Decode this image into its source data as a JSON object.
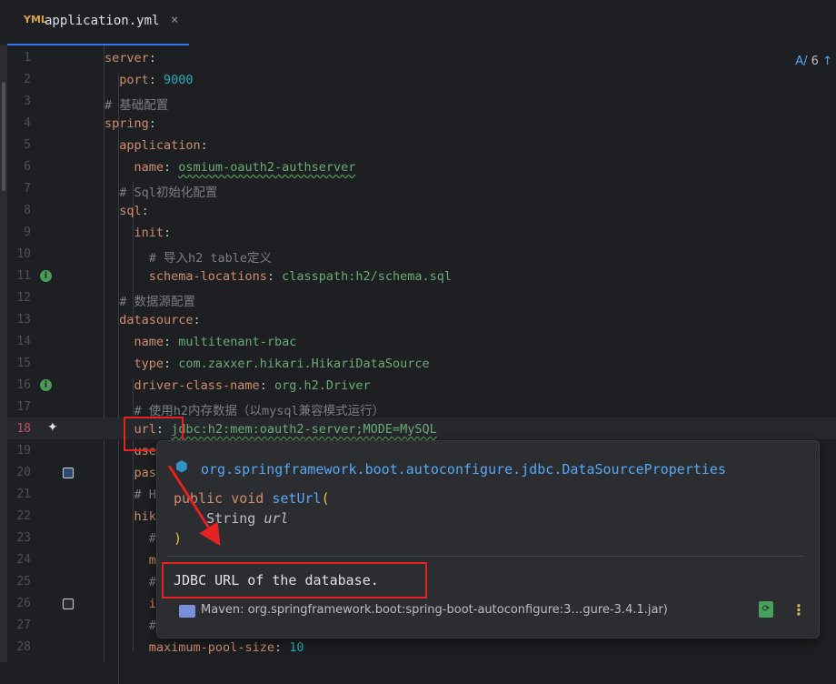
{
  "tab": {
    "icon": "yaml-file-icon",
    "icon_text": "YML",
    "title": "application.yml",
    "close": "×"
  },
  "top_right": {
    "inspection_icon": "A/",
    "count": "6",
    "arrow": "↑"
  },
  "lines": [
    {
      "n": "1",
      "segs": [
        {
          "t": "k",
          "v": "server"
        },
        {
          "t": "s",
          "v": ":"
        }
      ]
    },
    {
      "n": "2",
      "segs": [
        {
          "t": "s",
          "v": "  "
        },
        {
          "t": "k",
          "v": "port"
        },
        {
          "t": "s",
          "v": ": "
        },
        {
          "t": "n",
          "v": "9000"
        }
      ]
    },
    {
      "n": "3",
      "segs": [
        {
          "t": "c",
          "v": "# 基础配置"
        }
      ]
    },
    {
      "n": "4",
      "segs": [
        {
          "t": "k",
          "v": "spring"
        },
        {
          "t": "s",
          "v": ":"
        }
      ]
    },
    {
      "n": "5",
      "segs": [
        {
          "t": "s",
          "v": "  "
        },
        {
          "t": "k",
          "v": "application"
        },
        {
          "t": "s",
          "v": ":"
        }
      ]
    },
    {
      "n": "6",
      "segs": [
        {
          "t": "s",
          "v": "    "
        },
        {
          "t": "k",
          "v": "name"
        },
        {
          "t": "s",
          "v": ": "
        },
        {
          "t": "v",
          "v": "osmium-oauth2-authserver"
        }
      ]
    },
    {
      "n": "7",
      "segs": [
        {
          "t": "s",
          "v": "  "
        },
        {
          "t": "c",
          "v": "# Sql初始化配置"
        }
      ]
    },
    {
      "n": "8",
      "segs": [
        {
          "t": "s",
          "v": "  "
        },
        {
          "t": "k",
          "v": "sql"
        },
        {
          "t": "s",
          "v": ":"
        }
      ]
    },
    {
      "n": "9",
      "segs": [
        {
          "t": "s",
          "v": "    "
        },
        {
          "t": "k",
          "v": "init"
        },
        {
          "t": "s",
          "v": ":"
        }
      ]
    },
    {
      "n": "10",
      "segs": [
        {
          "t": "s",
          "v": "      "
        },
        {
          "t": "c",
          "v": "# 导入h2 table定义"
        }
      ]
    },
    {
      "n": "11",
      "gutter": "info",
      "segs": [
        {
          "t": "s",
          "v": "      "
        },
        {
          "t": "k",
          "v": "schema-locations"
        },
        {
          "t": "s",
          "v": ": "
        },
        {
          "t": "v",
          "v": "classpath:h2/schema.sql"
        }
      ]
    },
    {
      "n": "12",
      "segs": [
        {
          "t": "s",
          "v": "  "
        },
        {
          "t": "c",
          "v": "# 数据源配置"
        }
      ]
    },
    {
      "n": "13",
      "segs": [
        {
          "t": "s",
          "v": "  "
        },
        {
          "t": "k",
          "v": "datasource"
        },
        {
          "t": "s",
          "v": ":"
        }
      ]
    },
    {
      "n": "14",
      "segs": [
        {
          "t": "s",
          "v": "    "
        },
        {
          "t": "k",
          "v": "name"
        },
        {
          "t": "s",
          "v": ": "
        },
        {
          "t": "v",
          "v": "multitenant-rbac"
        }
      ]
    },
    {
      "n": "15",
      "segs": [
        {
          "t": "s",
          "v": "    "
        },
        {
          "t": "k",
          "v": "type"
        },
        {
          "t": "s",
          "v": ": "
        },
        {
          "t": "v",
          "v": "com.zaxxer.hikari.HikariDataSource"
        }
      ]
    },
    {
      "n": "16",
      "gutter": "info",
      "segs": [
        {
          "t": "s",
          "v": "    "
        },
        {
          "t": "k",
          "v": "driver-class-name"
        },
        {
          "t": "s",
          "v": ": "
        },
        {
          "t": "v",
          "v": "org.h2.Driver"
        }
      ]
    },
    {
      "n": "17",
      "segs": [
        {
          "t": "s",
          "v": "    "
        },
        {
          "t": "c",
          "v": "# 使用h2内存数据（以mysql兼容模式运行）"
        }
      ]
    },
    {
      "n": "18",
      "cur": true,
      "gutter": "star",
      "segs": [
        {
          "t": "s",
          "v": "    "
        },
        {
          "t": "k",
          "v": "url"
        },
        {
          "t": "s",
          "v": ": "
        },
        {
          "t": "v",
          "v": "jdbc:h2:mem:oauth2-server;MODE=MySQL"
        }
      ]
    },
    {
      "n": "19",
      "segs": [
        {
          "t": "s",
          "v": "    "
        },
        {
          "t": "k",
          "v": "use"
        }
      ]
    },
    {
      "n": "20",
      "gutter": "sq",
      "segs": [
        {
          "t": "s",
          "v": "    "
        },
        {
          "t": "k",
          "v": "pas"
        }
      ]
    },
    {
      "n": "21",
      "segs": [
        {
          "t": "s",
          "v": "    "
        },
        {
          "t": "c",
          "v": "# H"
        }
      ]
    },
    {
      "n": "22",
      "segs": [
        {
          "t": "s",
          "v": "    "
        },
        {
          "t": "k",
          "v": "hik"
        }
      ]
    },
    {
      "n": "23",
      "segs": [
        {
          "t": "s",
          "v": "      "
        },
        {
          "t": "c",
          "v": "#"
        }
      ]
    },
    {
      "n": "24",
      "segs": [
        {
          "t": "s",
          "v": "      "
        },
        {
          "t": "k",
          "v": "m"
        }
      ]
    },
    {
      "n": "25",
      "segs": [
        {
          "t": "s",
          "v": "      "
        },
        {
          "t": "c",
          "v": "#"
        }
      ]
    },
    {
      "n": "26",
      "gutter": "sqdark",
      "segs": [
        {
          "t": "s",
          "v": "      "
        },
        {
          "t": "k",
          "v": "i"
        }
      ]
    },
    {
      "n": "27",
      "segs": [
        {
          "t": "s",
          "v": "      "
        },
        {
          "t": "c",
          "v": "#"
        }
      ]
    },
    {
      "n": "28",
      "segs": [
        {
          "t": "s",
          "v": "      "
        },
        {
          "t": "k",
          "v": "maximum-pool-size"
        },
        {
          "t": "s",
          "v": ": "
        },
        {
          "t": "n",
          "v": "10"
        }
      ]
    }
  ],
  "popup": {
    "package": "org.springframework.boot.autoconfigure.jdbc.DataSourceProperties",
    "sig_public": "public",
    "sig_void": "void",
    "sig_method": "setUrl",
    "sig_open": "(",
    "sig_type": "String",
    "sig_arg": "url",
    "sig_close": ")",
    "description": "JDBC URL of the database.",
    "maven": "Maven: org.springframework.boot:spring-boot-autoconfigure:3…gure-3.4.1.jar)",
    "jar_icon": "jar-icon",
    "more": "⋮"
  },
  "colors": {
    "accent": "#3574f0",
    "highlight_box": "#e62222"
  }
}
